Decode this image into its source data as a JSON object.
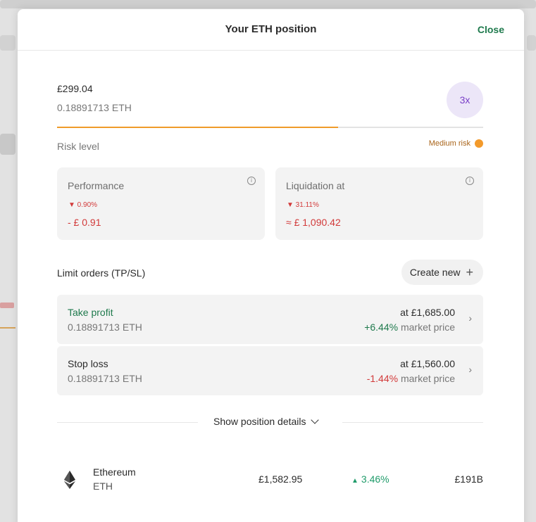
{
  "modal": {
    "title": "Your ETH position",
    "close_label": "Close"
  },
  "position": {
    "value": "£299.04",
    "amount_eth": "0.18891713 ETH",
    "leverage": "3x",
    "risk_level_label": "Risk level",
    "risk_badge": "Medium risk",
    "risk_fraction": 0.66,
    "risk_color": "#ef9b2a"
  },
  "stats": {
    "performance": {
      "title": "Performance",
      "pct": "▼ 0.90%",
      "value": "- £ 0.91"
    },
    "liquidation": {
      "title": "Liquidation at",
      "pct": "▼ 31.11%",
      "value": "≈ £ 1,090.42"
    },
    "info_icon": "info-icon"
  },
  "limit_orders": {
    "title": "Limit orders (TP/SL)",
    "create_label": "Create new",
    "orders": [
      {
        "name": "Take profit",
        "amount": "0.18891713 ETH",
        "price": "at £1,685.00",
        "pct": "+6.44%",
        "suffix": " market price"
      },
      {
        "name": "Stop loss",
        "amount": "0.18891713 ETH",
        "price": "at £1,560.00",
        "pct": "-1.44%",
        "suffix": " market price"
      }
    ]
  },
  "details_label": "Show position details",
  "asset": {
    "name": "Ethereum",
    "ticker": "ETH",
    "price": "£1,582.95",
    "change": "3.46%",
    "market_cap": "£191B"
  },
  "colors": {
    "accent_green": "#1f7a4d",
    "negative_red": "#d23a3a",
    "positive_green": "#1f9b6a",
    "leverage_purple": "#7a3fc8",
    "risk_orange": "#f39a2b"
  }
}
